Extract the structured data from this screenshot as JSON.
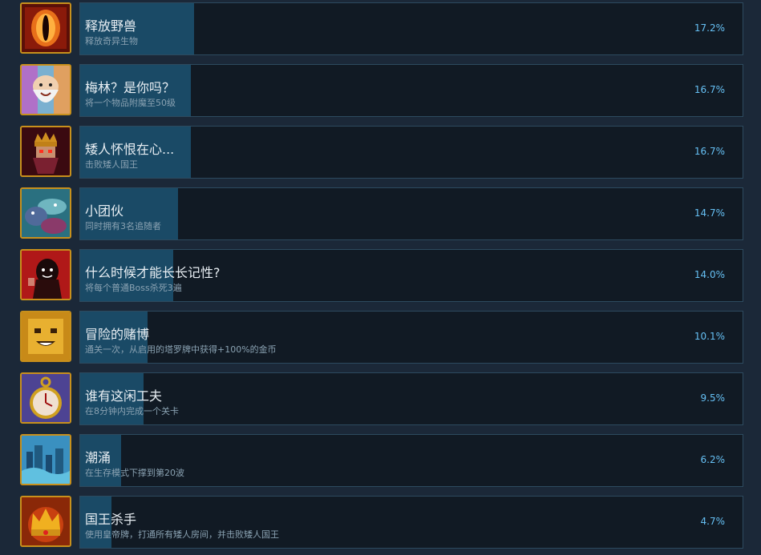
{
  "achievements": [
    {
      "title": "释放野兽",
      "description": "释放奇异生物",
      "percent": "17.2%",
      "icon": "beast-eye-icon",
      "fill": 0.172
    },
    {
      "title": "梅林？是你吗？",
      "description": "将一个物品附魔至50级",
      "percent": "16.7%",
      "icon": "merlin-wizard-icon",
      "fill": 0.167
    },
    {
      "title": "矮人怀恨在心...",
      "description": "击败矮人国王",
      "percent": "16.7%",
      "icon": "dwarf-king-icon",
      "fill": 0.167
    },
    {
      "title": "小团伙",
      "description": "同时拥有3名追随者",
      "percent": "14.7%",
      "icon": "followers-gang-icon",
      "fill": 0.147
    },
    {
      "title": "什么时候才能长长记性?",
      "description": "将每个普通Boss杀死3遍",
      "percent": "14.0%",
      "icon": "hooded-figure-icon",
      "fill": 0.14
    },
    {
      "title": "冒险的赌博",
      "description": "通关一次，从启用的塔罗牌中获得+100%的金币",
      "percent": "10.1%",
      "icon": "golden-face-icon",
      "fill": 0.101
    },
    {
      "title": "谁有这闲工夫",
      "description": "在8分钟内完成一个关卡",
      "percent": "9.5%",
      "icon": "pocket-watch-icon",
      "fill": 0.095
    },
    {
      "title": "潮涌",
      "description": "在生存模式下撑到第20波",
      "percent": "6.2%",
      "icon": "tidal-city-icon",
      "fill": 0.062
    },
    {
      "title": "国王杀手",
      "description": "使用皇帝牌，打通所有矮人房间，并击败矮人国王",
      "percent": "4.7%",
      "icon": "golden-crown-icon",
      "fill": 0.047
    }
  ]
}
